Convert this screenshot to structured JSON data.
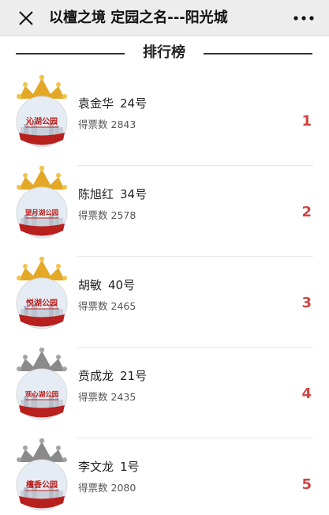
{
  "topbar": {
    "title": "以檀之境 定园之名---阳光城"
  },
  "section": {
    "title": "排行榜"
  },
  "colors": {
    "accent_red": "#d04444",
    "gold_crown": "#e3a826",
    "silver_crown": "#8a8a8a",
    "label_red": "#b8201e"
  },
  "ranking": [
    {
      "name": "袁金华",
      "number": "24号",
      "votes_label": "得票数",
      "votes": "2843",
      "rank": "1",
      "park": "沁湖公园",
      "crown": "gold"
    },
    {
      "name": "陈旭红",
      "number": "34号",
      "votes_label": "得票数",
      "votes": "2578",
      "rank": "2",
      "park": "望月湖公园",
      "crown": "gold"
    },
    {
      "name": "胡敏",
      "number": "40号",
      "votes_label": "得票数",
      "votes": "2465",
      "rank": "3",
      "park": "悦湖公园",
      "crown": "gold"
    },
    {
      "name": "贲成龙",
      "number": "21号",
      "votes_label": "得票数",
      "votes": "2435",
      "rank": "4",
      "park": "观心湖公园",
      "crown": "silver"
    },
    {
      "name": "李文龙",
      "number": "1号",
      "votes_label": "得票数",
      "votes": "2080",
      "rank": "5",
      "park": "檀香公园",
      "crown": "silver"
    }
  ]
}
